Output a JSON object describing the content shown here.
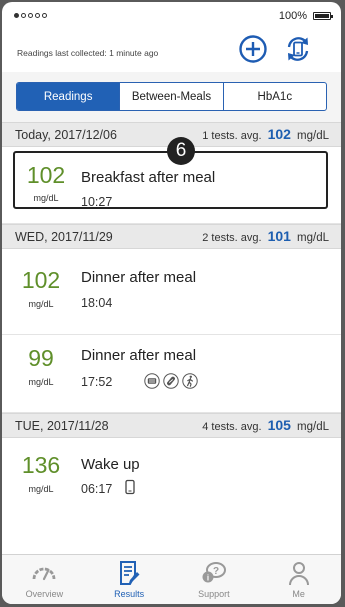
{
  "status_bar": {
    "battery_pct": "100%",
    "battery_level": 1.0
  },
  "header": {
    "collected_text": "Readings last collected:  1 minute ago"
  },
  "tabs": [
    {
      "label": "Readings",
      "active": true
    },
    {
      "label": "Between-Meals",
      "active": false
    },
    {
      "label": "HbA1c",
      "active": false
    }
  ],
  "days": [
    {
      "date": "Today, 2017/12/06",
      "tests": "1 tests. avg.",
      "avg": "102",
      "unit": "mg/dL",
      "entries": [
        {
          "value": "102",
          "unit": "mg/dL",
          "label": "Breakfast after meal",
          "time": "10:27",
          "marker": "6"
        }
      ]
    },
    {
      "date": "WED, 2017/11/29",
      "tests": "2 tests. avg.",
      "avg": "101",
      "unit": "mg/dL",
      "entries": [
        {
          "value": "102",
          "unit": "mg/dL",
          "label": "Dinner after meal",
          "time": "18:04"
        },
        {
          "value": "99",
          "unit": "mg/dL",
          "label": "Dinner after meal",
          "time": "17:52",
          "icons": [
            "meal-icon",
            "medication-icon",
            "exercise-icon"
          ]
        }
      ]
    },
    {
      "date": "TUE, 2017/11/28",
      "tests": "4 tests. avg.",
      "avg": "105",
      "unit": "mg/dL",
      "entries": [
        {
          "value": "136",
          "unit": "mg/dL",
          "label": "Wake up",
          "time": "06:17",
          "icons": [
            "phone-icon"
          ]
        }
      ]
    }
  ],
  "colors": {
    "accent": "#2161b5",
    "reading": "#5f8f2a",
    "average": "#1d5eb0"
  },
  "nav": [
    {
      "label": "Overview",
      "icon": "gauge-icon",
      "active": false
    },
    {
      "label": "Results",
      "icon": "results-icon",
      "active": true
    },
    {
      "label": "Support",
      "icon": "support-icon",
      "active": false
    },
    {
      "label": "Me",
      "icon": "person-icon",
      "active": false
    }
  ]
}
